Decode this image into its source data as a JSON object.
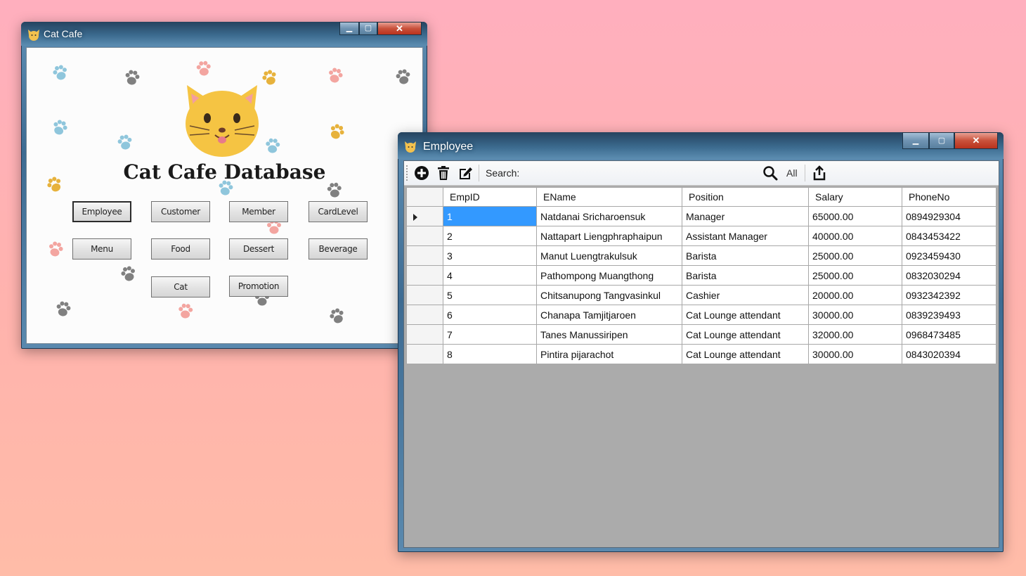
{
  "cat_window": {
    "title": "Cat Cafe",
    "heading": "Cat Cafe Database",
    "buttons": {
      "employee": "Employee",
      "customer": "Customer",
      "member": "Member",
      "cardlevel": "CardLevel",
      "menu": "Menu",
      "food": "Food",
      "dessert": "Dessert",
      "beverage": "Beverage",
      "cat": "Cat",
      "promotion": "Promotion"
    }
  },
  "employee_window": {
    "title": "Employee",
    "toolbar": {
      "search_label": "Search:",
      "search_value": "",
      "all_label": "All",
      "icons": [
        "add-icon",
        "delete-icon",
        "edit-icon",
        "search-icon",
        "export-icon"
      ]
    },
    "table": {
      "columns": [
        "EmpID",
        "EName",
        "Position",
        "Salary",
        "PhoneNo"
      ],
      "rows": [
        [
          "1",
          "Natdanai Sricharoensuk",
          "Manager",
          "65000.00",
          "0894929304"
        ],
        [
          "2",
          "Nattapart Liengphraphaipun",
          "Assistant Manager",
          "40000.00",
          "0843453422"
        ],
        [
          "3",
          "Manut Luengtrakulsuk",
          "Barista",
          "25000.00",
          "0923459430"
        ],
        [
          "4",
          "Pathompong Muangthong",
          "Barista",
          "25000.00",
          "0832030294"
        ],
        [
          "5",
          "Chitsanupong Tangvasinkul",
          "Cashier",
          "20000.00",
          "0932342392"
        ],
        [
          "6",
          "Chanapa Tamjitjaroen",
          "Cat Lounge attendant",
          "30000.00",
          "0839239493"
        ],
        [
          "7",
          "Tanes Manussiripen",
          "Cat Lounge attendant",
          "32000.00",
          "0968473485"
        ],
        [
          "8",
          "Pintira pijarachot",
          "Cat Lounge attendant",
          "30000.00",
          "0843020394"
        ]
      ],
      "selected_row": 0
    }
  },
  "colors": {
    "background_top": "#ffafbe",
    "background_bottom": "#ffbca8",
    "selection": "#3399ff",
    "paw_blue": "#8fc6dc",
    "paw_pink": "#f3a5a0",
    "paw_gold": "#e7b23c",
    "paw_gray": "#808080"
  }
}
